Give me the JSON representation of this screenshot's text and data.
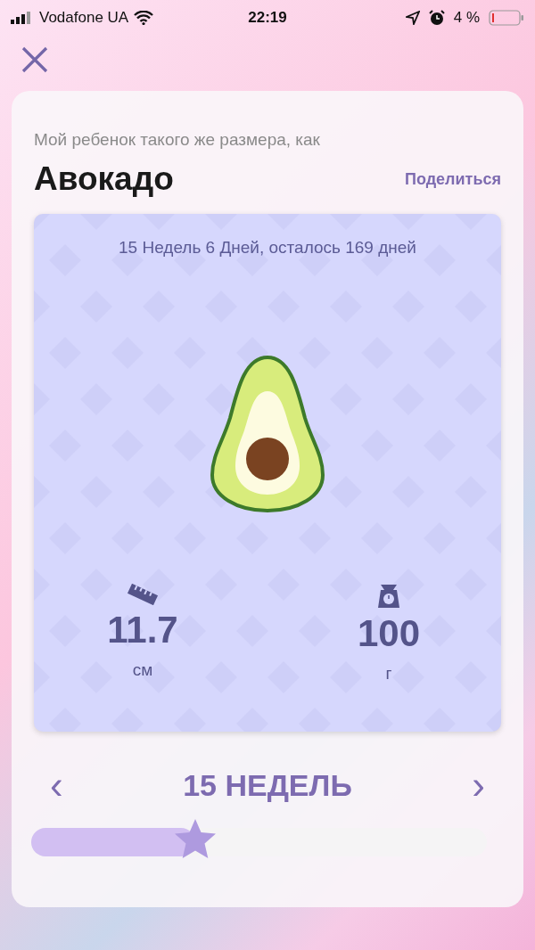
{
  "status_bar": {
    "carrier": "Vodafone UA",
    "time": "22:19",
    "battery": "4 %"
  },
  "card": {
    "subtitle": "Мой ребенок такого же размера, как",
    "title": "Авокадо",
    "share": "Поделиться",
    "panel": {
      "progress_text": "15 Недель 6 Дней, осталось 169 дней",
      "stats": [
        {
          "kind": "length",
          "value": "11.7",
          "unit": "см"
        },
        {
          "kind": "weight",
          "value": "100",
          "unit": "г"
        }
      ]
    },
    "week": {
      "label": "15 НЕДЕЛЬ",
      "prev": "‹",
      "next": "›"
    },
    "slider": {
      "level": 0.36
    }
  }
}
